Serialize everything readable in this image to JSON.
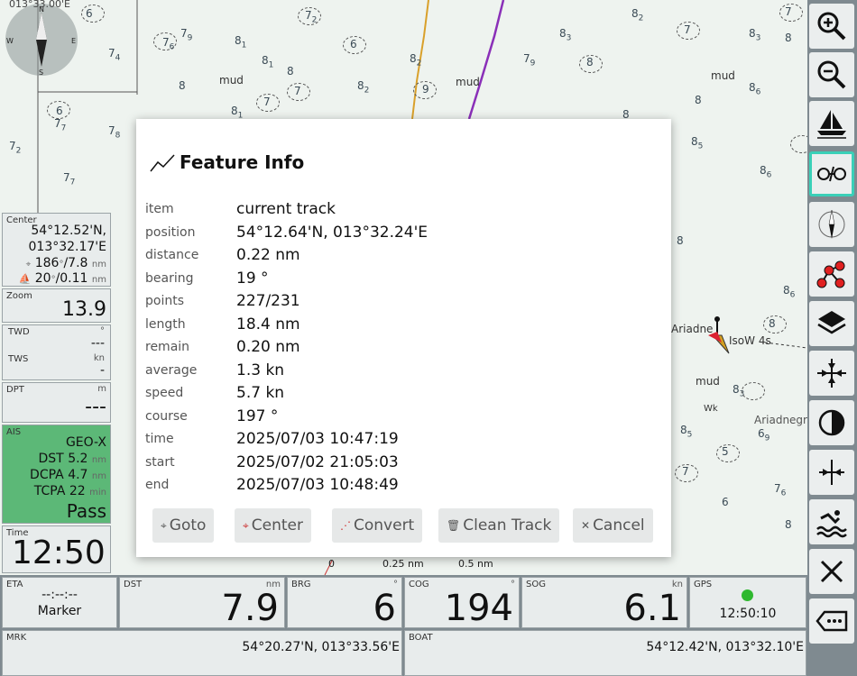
{
  "map": {
    "coord_label": "013°33.00'E",
    "mud_labels": [
      "mud",
      "mud",
      "mud",
      "mud"
    ],
    "feature_labels": [
      "Ariadne",
      "IsoW 4s",
      "Ariadnegr",
      "Wk"
    ],
    "scale": [
      "0",
      "0.25 nm",
      "0.5 nm"
    ]
  },
  "dialog": {
    "title": "Feature Info",
    "rows": [
      {
        "key": "item",
        "value": "current track"
      },
      {
        "key": "position",
        "value": "54°12.64'N, 013°32.24'E"
      },
      {
        "key": "distance",
        "value": "0.22 nm"
      },
      {
        "key": "bearing",
        "value": "19 °"
      },
      {
        "key": "points",
        "value": "227/231"
      },
      {
        "key": "length",
        "value": "18.4 nm"
      },
      {
        "key": "remain",
        "value": "0.20 nm"
      },
      {
        "key": "average",
        "value": "1.3 kn"
      },
      {
        "key": "speed",
        "value": "5.7 kn"
      },
      {
        "key": "course",
        "value": "197 °"
      },
      {
        "key": "time",
        "value": "2025/07/03 10:47:19"
      },
      {
        "key": "start",
        "value": "2025/07/02 21:05:03"
      },
      {
        "key": "end",
        "value": "2025/07/03 10:48:49"
      }
    ],
    "buttons": {
      "goto": "Goto",
      "center": "Center",
      "convert": "Convert",
      "clean": "Clean Track",
      "cancel": "Cancel"
    }
  },
  "left": {
    "center": {
      "label": "Center",
      "lat": "54°12.52'N,",
      "lon": "013°32.17'E",
      "brg": "186",
      "dist": "/7.8",
      "brg2": "20",
      "dist2": "/0.11",
      "unit": "nm"
    },
    "zoom": {
      "label": "Zoom",
      "value": "13.9"
    },
    "wind": {
      "twd_label": "TWD",
      "twd_unit": "°",
      "twd_value": "---",
      "tws_label": "TWS",
      "tws_unit": "kn",
      "tws_value": "-"
    },
    "dpt": {
      "label": "DPT",
      "unit": "m",
      "value": "---"
    },
    "ais": {
      "label": "AIS",
      "name": "GEO-X",
      "dst_label": "DST",
      "dst": "5.2",
      "dst_unit": "nm",
      "dcpa_label": "DCPA",
      "dcpa": "4.7",
      "dcpa_unit": "nm",
      "tcpa_label": "TCPA",
      "tcpa": "22",
      "tcpa_unit": "min",
      "status": "Pass"
    },
    "time": {
      "label": "Time",
      "value": "12:50"
    }
  },
  "bottom": {
    "eta": {
      "label": "ETA",
      "value": "--:--:--",
      "sub": "Marker"
    },
    "dst": {
      "label": "DST",
      "unit": "nm",
      "value": "7.9"
    },
    "brg": {
      "label": "BRG",
      "unit": "°",
      "value": "6"
    },
    "cog": {
      "label": "COG",
      "unit": "°",
      "value": "194"
    },
    "sog": {
      "label": "SOG",
      "unit": "kn",
      "value": "6.1"
    },
    "gps": {
      "label": "GPS",
      "time": "12:50:10"
    },
    "mrk": {
      "label": "MRK",
      "value": "54°20.27'N, 013°33.56'E"
    },
    "boat": {
      "label": "BOAT",
      "value": "54°12.42'N, 013°32.10'E"
    }
  },
  "colors": {
    "ais_bg": "#5cb877",
    "gps_ok": "#2fb82f",
    "track_orange": "#d9a02a",
    "track_purple": "#8a2fb8",
    "active_border": "#3ad0b8"
  }
}
